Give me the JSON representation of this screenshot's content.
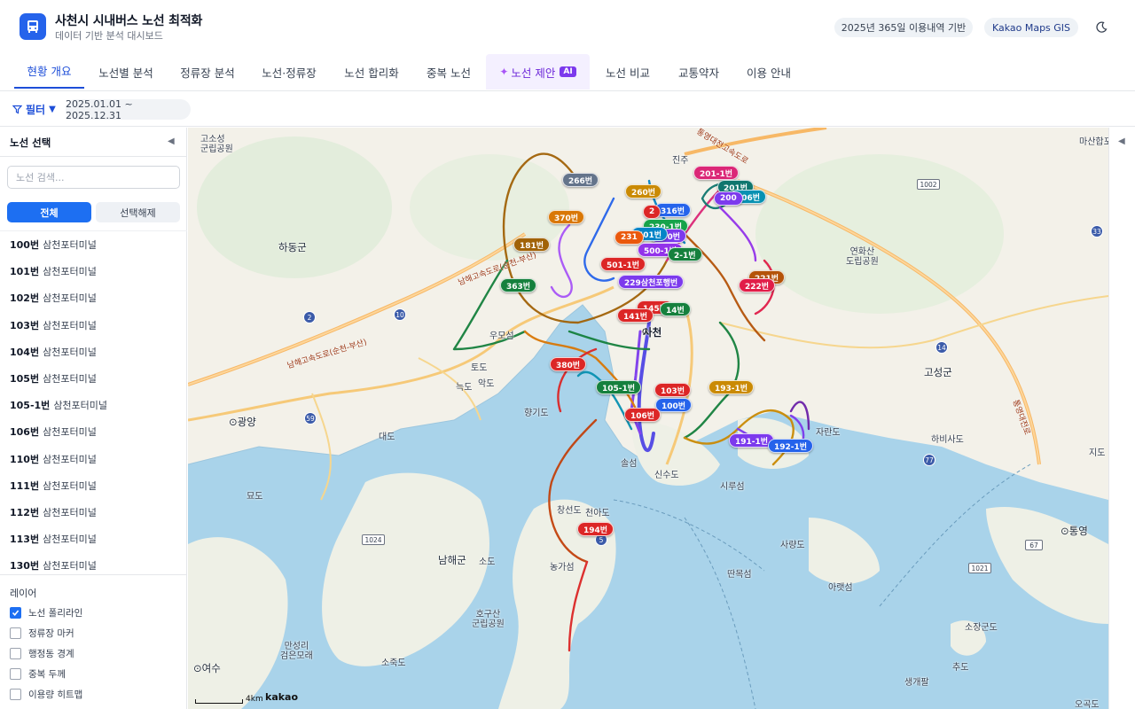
{
  "app": {
    "title": "사천시 시내버스 노선 최적화",
    "subtitle": "데이터 기반 분석 대시보드",
    "usage_pill": "2025년 365일 이용내역 기반",
    "gis_pill": "Kakao Maps GIS",
    "theme_icon": "moon-icon"
  },
  "tabs": [
    {
      "label": "현황 개요",
      "active": true
    },
    {
      "label": "노선별 분석"
    },
    {
      "label": "정류장 분석"
    },
    {
      "label": "노선·정류장"
    },
    {
      "label": "노선 합리화"
    },
    {
      "label": "중복 노선"
    },
    {
      "label": "노선 제안",
      "badge": "AI"
    },
    {
      "label": "노선 비교"
    },
    {
      "label": "교통약자"
    },
    {
      "label": "이용 안내"
    }
  ],
  "filter": {
    "label": "필터",
    "date_range": "2025.01.01 ~ 2025.12.31"
  },
  "sidebar": {
    "title": "노선 선택",
    "search_placeholder": "노선 검색...",
    "select_all": "전체",
    "deselect_all": "선택해제",
    "routes": [
      {
        "number": "100번",
        "terminal": "삼천포터미널"
      },
      {
        "number": "101번",
        "terminal": "삼천포터미널"
      },
      {
        "number": "102번",
        "terminal": "삼천포터미널"
      },
      {
        "number": "103번",
        "terminal": "삼천포터미널"
      },
      {
        "number": "104번",
        "terminal": "삼천포터미널"
      },
      {
        "number": "105번",
        "terminal": "삼천포터미널"
      },
      {
        "number": "105-1번",
        "terminal": "삼천포터미널"
      },
      {
        "number": "106번",
        "terminal": "삼천포터미널"
      },
      {
        "number": "110번",
        "terminal": "삼천포터미널"
      },
      {
        "number": "111번",
        "terminal": "삼천포터미널"
      },
      {
        "number": "112번",
        "terminal": "삼천포터미널"
      },
      {
        "number": "113번",
        "terminal": "삼천포터미널"
      },
      {
        "number": "130번",
        "terminal": "삼천포터미널"
      }
    ],
    "layers_title": "레이어",
    "layers": [
      {
        "label": "노선 폴리라인",
        "checked": true
      },
      {
        "label": "정류장 마커",
        "checked": false
      },
      {
        "label": "행정동 경계",
        "checked": false
      },
      {
        "label": "중복 두께",
        "checked": false
      },
      {
        "label": "이용량 히트맵",
        "checked": false
      }
    ]
  },
  "map": {
    "places": [
      {
        "name": "고소성\n군립공원"
      },
      {
        "name": "하동군"
      },
      {
        "name": "광양"
      },
      {
        "name": "묘도"
      },
      {
        "name": "대도"
      },
      {
        "name": "남해군"
      },
      {
        "name": "소도"
      },
      {
        "name": "호구산\n군립공원"
      },
      {
        "name": "소죽도"
      },
      {
        "name": "여수"
      },
      {
        "name": "만성리\n검은모래"
      },
      {
        "name": "우모섬"
      },
      {
        "name": "토도"
      },
      {
        "name": "늑도"
      },
      {
        "name": "악도"
      },
      {
        "name": "향기도"
      },
      {
        "name": "창선도"
      },
      {
        "name": "천아도"
      },
      {
        "name": "농가섬"
      },
      {
        "name": "사천"
      },
      {
        "name": "진주"
      },
      {
        "name": "연화산\n도립공원"
      },
      {
        "name": "고성군"
      },
      {
        "name": "하비사도"
      },
      {
        "name": "자란도"
      },
      {
        "name": "신수도"
      },
      {
        "name": "시루섬"
      },
      {
        "name": "솔섬"
      },
      {
        "name": "사량도"
      },
      {
        "name": "딴목섬"
      },
      {
        "name": "아랫섬"
      },
      {
        "name": "통영"
      },
      {
        "name": "마산합포구"
      },
      {
        "name": "오곡도"
      },
      {
        "name": "추도"
      },
      {
        "name": "소장군도"
      },
      {
        "name": "생개팔"
      },
      {
        "name": "지도"
      }
    ],
    "road_labels": [
      "남해고속도로(순천-부산)",
      "남해고속도로(순천-부산)",
      "통영대전고속도로",
      "통영대전로"
    ],
    "road_numbers": [
      "2",
      "10",
      "59",
      "14",
      "77",
      "5",
      "33",
      "1002",
      "1024",
      "1021",
      "67"
    ],
    "bus_labels": [
      {
        "label": "201-1번",
        "color": "#db2777"
      },
      {
        "label": "201번",
        "color": "#0f766e"
      },
      {
        "label": "206번",
        "color": "#0891b2"
      },
      {
        "label": "200",
        "color": "#7c3aed"
      },
      {
        "label": "266번",
        "color": "#64748b"
      },
      {
        "label": "260번",
        "color": "#ca8a04"
      },
      {
        "label": "370번",
        "color": "#d97706"
      },
      {
        "label": "316번",
        "color": "#2563eb"
      },
      {
        "label": "2",
        "color": "#dc2626"
      },
      {
        "label": "230-1번",
        "color": "#16a34a"
      },
      {
        "label": "500번",
        "color": "#7c3aed"
      },
      {
        "label": "501번",
        "color": "#0284c7"
      },
      {
        "label": "231",
        "color": "#ea580c"
      },
      {
        "label": "500-1번",
        "color": "#9333ea"
      },
      {
        "label": "2-1번",
        "color": "#15803d"
      },
      {
        "label": "181번",
        "color": "#a16207"
      },
      {
        "label": "501-1번",
        "color": "#dc2626"
      },
      {
        "label": "229삼천포행번",
        "color": "#7c3aed"
      },
      {
        "label": "221번",
        "color": "#b45309"
      },
      {
        "label": "222번",
        "color": "#e11d48"
      },
      {
        "label": "363번",
        "color": "#15803d"
      },
      {
        "label": "145번",
        "color": "#dc2626"
      },
      {
        "label": "141번",
        "color": "#dc2626"
      },
      {
        "label": "14번",
        "color": "#15803d"
      },
      {
        "label": "380번",
        "color": "#dc2626"
      },
      {
        "label": "105-1번",
        "color": "#15803d"
      },
      {
        "label": "103번",
        "color": "#dc2626"
      },
      {
        "label": "100번",
        "color": "#2563eb"
      },
      {
        "label": "193-1번",
        "color": "#ca8a04"
      },
      {
        "label": "106번",
        "color": "#dc2626"
      },
      {
        "label": "191-1번",
        "color": "#7c3aed"
      },
      {
        "label": "192-1번",
        "color": "#2563eb"
      },
      {
        "label": "194번",
        "color": "#dc2626"
      }
    ],
    "center_label": "사천",
    "scale_text": "4km",
    "brand": "kakao"
  }
}
